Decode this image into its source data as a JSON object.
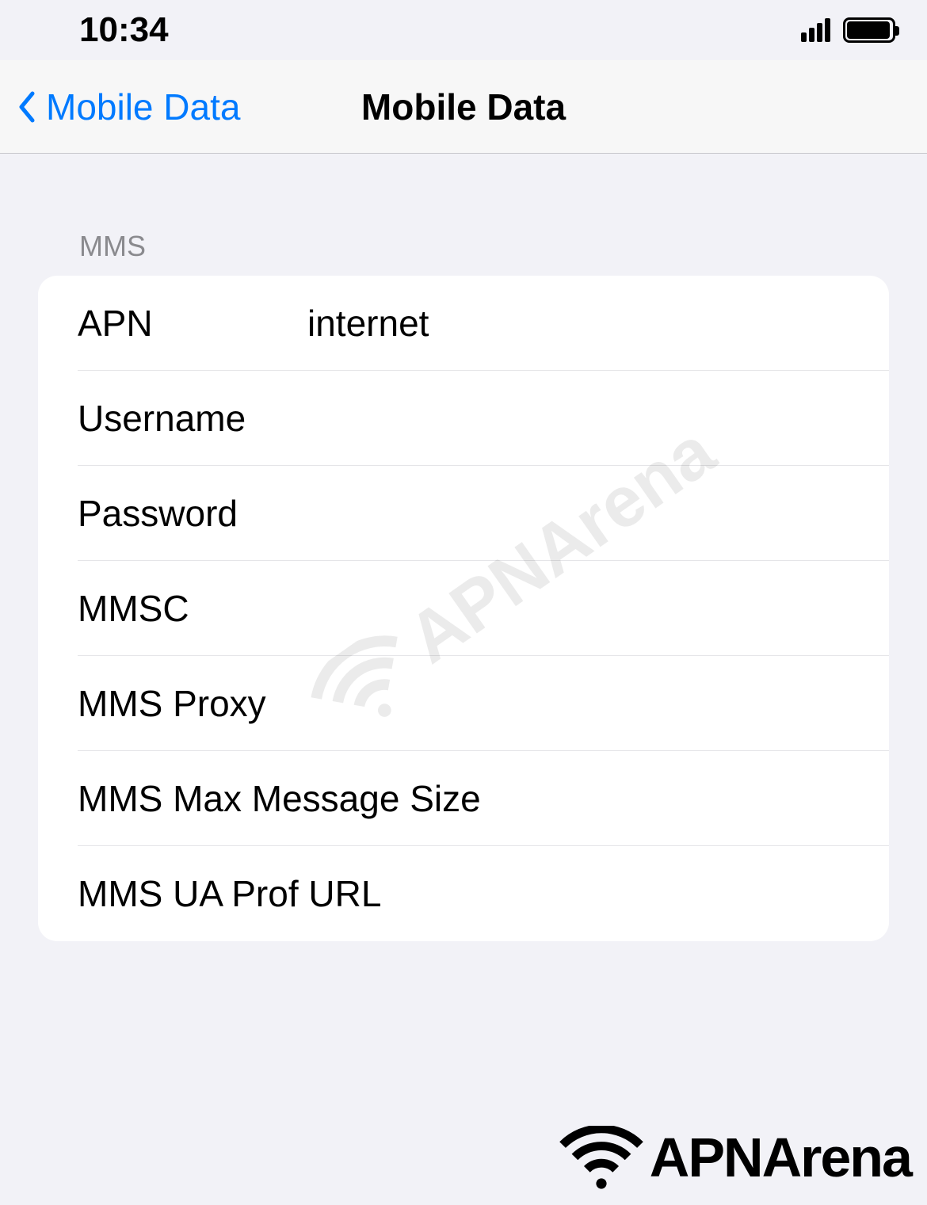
{
  "status": {
    "time": "10:34"
  },
  "nav": {
    "back_label": "Mobile Data",
    "title": "Mobile Data"
  },
  "section": {
    "header": "MMS",
    "rows": [
      {
        "label": "APN",
        "value": "internet"
      },
      {
        "label": "Username",
        "value": ""
      },
      {
        "label": "Password",
        "value": ""
      },
      {
        "label": "MMSC",
        "value": ""
      },
      {
        "label": "MMS Proxy",
        "value": ""
      },
      {
        "label": "MMS Max Message Size",
        "value": ""
      },
      {
        "label": "MMS UA Prof URL",
        "value": ""
      }
    ]
  },
  "watermark": {
    "text": "APNArena"
  },
  "footer": {
    "text": "APNArena"
  }
}
